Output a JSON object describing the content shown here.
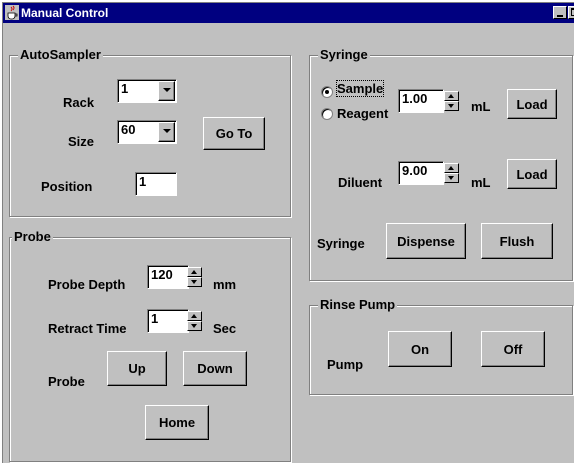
{
  "window": {
    "title": "Manual Control",
    "icon": "java-coffee-cup-icon"
  },
  "autosampler": {
    "legend": "AutoSampler",
    "rack_label": "Rack",
    "rack_value": "1",
    "size_label": "Size",
    "size_value": "60",
    "goto_label": "Go To",
    "position_label": "Position",
    "position_value": "1"
  },
  "probe": {
    "legend": "Probe",
    "depth_label": "Probe Depth",
    "depth_value": "120",
    "depth_unit": "mm",
    "retract_label": "Retract Time",
    "retract_value": "1",
    "retract_unit": "Sec",
    "probe_label": "Probe",
    "up_label": "Up",
    "down_label": "Down",
    "home_label": "Home"
  },
  "syringe": {
    "legend": "Syringe",
    "sample_label": "Sample",
    "reagent_label": "Reagent",
    "selected": "Sample",
    "volume_value": "1.00",
    "volume_unit": "mL",
    "load_label": "Load",
    "diluent_label": "Diluent",
    "diluent_value": "9.00",
    "diluent_unit": "mL",
    "diluent_load_label": "Load",
    "syringe_label": "Syringe",
    "dispense_label": "Dispense",
    "flush_label": "Flush"
  },
  "rinse_pump": {
    "legend": "Rinse Pump",
    "pump_label": "Pump",
    "on_label": "On",
    "off_label": "Off"
  },
  "colors": {
    "titlebar": "#000080",
    "face": "#c0c0c0"
  }
}
